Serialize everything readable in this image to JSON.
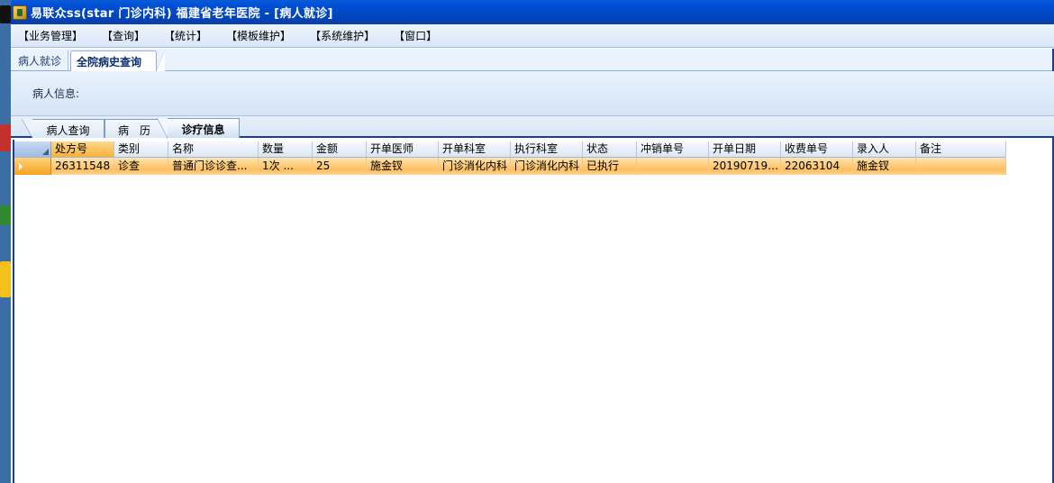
{
  "window": {
    "title": "易联众ss(star 门诊内科) 福建省老年医院 - [病人就诊]"
  },
  "menu": [
    {
      "label": "【业务管理】"
    },
    {
      "label": "【查询】"
    },
    {
      "label": "【统计】"
    },
    {
      "label": "【模板维护】"
    },
    {
      "label": "【系统维护】"
    },
    {
      "label": "【窗口】"
    }
  ],
  "top_tabs": [
    {
      "label": "病人就诊",
      "active": false
    },
    {
      "label": "全院病史查询",
      "active": true
    }
  ],
  "patient_info": {
    "label": "病人信息:"
  },
  "sub_tabs": [
    {
      "label": "病人查询",
      "active": false
    },
    {
      "label": "病历",
      "active": false
    },
    {
      "label": "诊疗信息",
      "active": true
    }
  ],
  "grid": {
    "columns": [
      "处方号",
      "类别",
      "名称",
      "数量",
      "金额",
      "开单医师",
      "开单科室",
      "执行科室",
      "状态",
      "冲销单号",
      "开单日期",
      "收费单号",
      "录入人",
      "备注"
    ],
    "rows": [
      {
        "prescription_no": "26311548",
        "category": "诊查",
        "name": "普通门诊诊查...",
        "quantity": "1次     ...",
        "amount": "25",
        "doctor": "施金钗",
        "dept": "门诊消化内科",
        "exec_dept": "门诊消化内科",
        "status": "已执行",
        "reversal_no": "",
        "order_date": "201907191...",
        "charge_no": "22063104",
        "entered_by": "施金钗",
        "remark": ""
      }
    ]
  },
  "colors": {
    "titlebar": "#0050d8",
    "selected_row": "#fdbf5e",
    "border_dark": "#1b3f8c"
  }
}
